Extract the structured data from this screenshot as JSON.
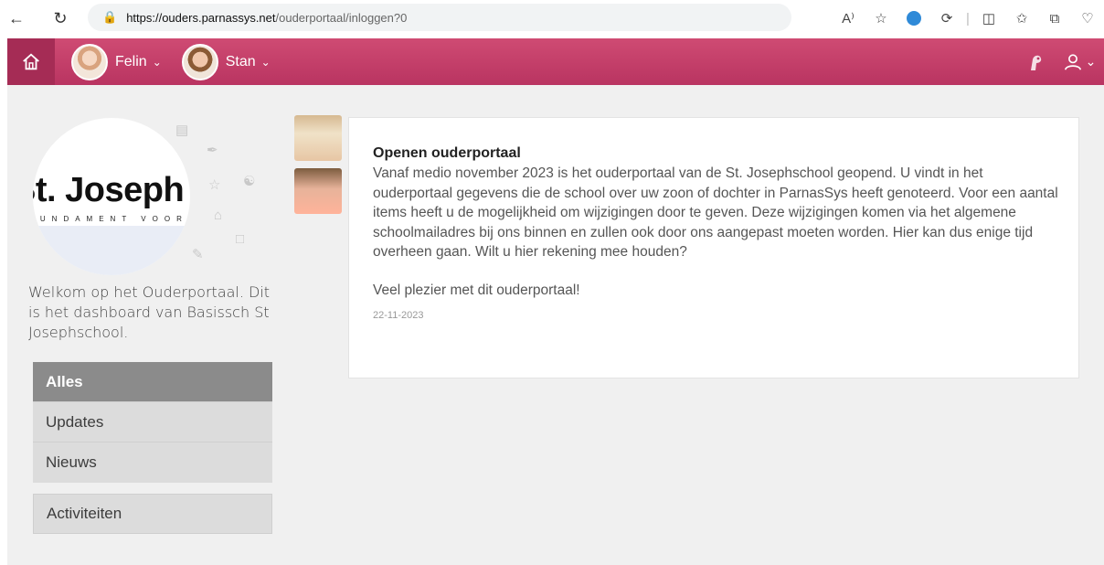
{
  "browser": {
    "url_host": "https://ouders.parnassys.net",
    "url_path": "/ouderportaal/inloggen?0"
  },
  "header": {
    "children": [
      {
        "name": "Felin"
      },
      {
        "name": "Stan"
      }
    ],
    "colors": {
      "accent": "#c43d68",
      "home_bg": "#a52c55"
    }
  },
  "sidebar": {
    "school_name": "St. Joseph",
    "school_sub": "FUNDAMENT VOOR",
    "welcome": "Welkom op het Ouderportaal. Dit is het dashboard van Basissch St Josephschool.",
    "filters": [
      {
        "label": "Alles",
        "active": true
      },
      {
        "label": "Updates",
        "active": false
      },
      {
        "label": "Nieuws",
        "active": false
      }
    ],
    "activities_label": "Activiteiten"
  },
  "news": {
    "title": "Openen ouderportaal",
    "body": "Vanaf medio november 2023 is het ouderportaal van de St. Josephschool geopend. U vindt in het ouderportaal gegevens die de school over uw zoon of dochter in ParnasSys heeft genoteerd. Voor een aantal items heeft u de mogelijkheid om wijzigingen door te geven. Deze wijzigingen komen via het algemene schoolmailadres bij ons binnen en zullen ook door ons aangepast moeten worden. Hier kan dus enige tijd overheen gaan. Wilt u hier rekening mee houden?",
    "closing": "Veel plezier met dit ouderportaal!",
    "date": "22-11-2023"
  }
}
